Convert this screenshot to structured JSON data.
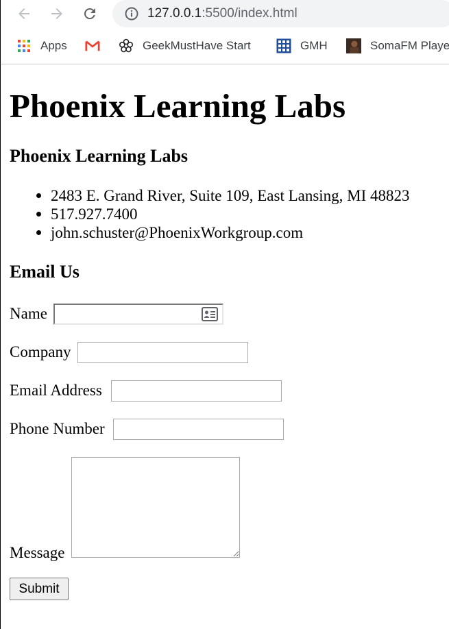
{
  "browser": {
    "url_host": "127.0.0.1",
    "url_rest": ":5500/index.html",
    "bookmarks": [
      {
        "label": "Apps",
        "icon": "apps-grid-icon"
      },
      {
        "label": "",
        "icon": "gmail-icon"
      },
      {
        "label": "GeekMustHave Start",
        "icon": "flower-icon"
      },
      {
        "label": "GMH",
        "icon": "grid-icon"
      },
      {
        "label": "SomaFM Playe",
        "icon": "soma-thumbnail-icon"
      }
    ]
  },
  "page": {
    "title": "Phoenix Learning Labs",
    "org_heading": "Phoenix Learning Labs",
    "contact_items": [
      "2483 E. Grand River, Suite 109, East Lansing, MI 48823",
      "517.927.7400",
      "john.schuster@PhoenixWorkgroup.com"
    ],
    "form_heading": "Email Us",
    "form": {
      "name_label": "Name",
      "name_value": "",
      "company_label": "Company",
      "company_value": "",
      "email_label": "Email Address",
      "email_value": "",
      "phone_label": "Phone Number",
      "phone_value": "",
      "message_label": "Message",
      "message_value": "",
      "submit_label": "Submit"
    }
  },
  "colors": {
    "omnibox_bg": "#f1f3f4",
    "icon_gray": "#5f6368",
    "input_border": "#a9a9a9",
    "button_bg": "#efefef"
  }
}
